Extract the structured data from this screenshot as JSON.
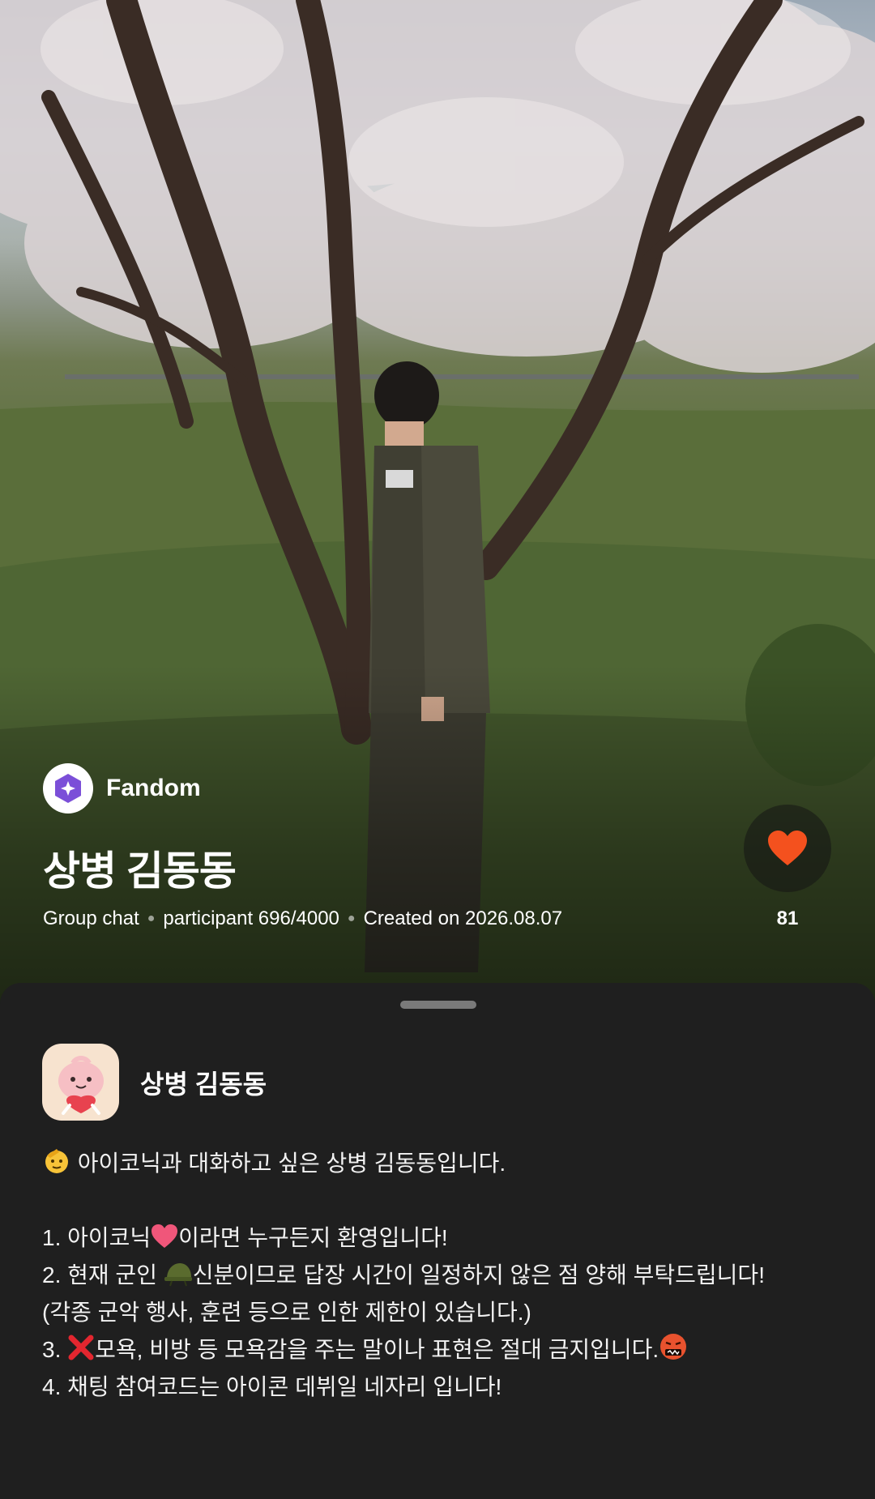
{
  "hero": {
    "photo": "cherry-blossom-soldier-photo",
    "community_type": "Fandom",
    "room_title": "상병 김동동",
    "meta": {
      "chat_type": "Group chat",
      "participants": "participant 696/4000",
      "created": "Created on 2026.08.07"
    },
    "like_count": "81",
    "like_color": "#f4511e",
    "fandom_badge_color": "#7b4fd8"
  },
  "sheet": {
    "host_name": "상병 김동동",
    "description": {
      "intro": "아이코닉과 대화하고 싶은 상병 김동동입니다.",
      "rule1_a": "1. 아이코닉",
      "rule1_b": "이라면 누구든지 환영입니다!",
      "rule2_a": "2. 현재 군인 ",
      "rule2_b": "신분이므로 답장 시간이 일정하지 않은 점 양해 부탁드립니다!",
      "rule2_note": "(각종 군악 행사, 훈련 등으로 인한 제한이 있습니다.)",
      "rule3_a": "3. ",
      "rule3_b": "모욕, 비방 등 모욕감을 주는 말이나 표현은 절대 금지입니다.",
      "rule4": "4. 채팅 참여코드는 아이콘 데뷔일 네자리 입니다!"
    }
  }
}
